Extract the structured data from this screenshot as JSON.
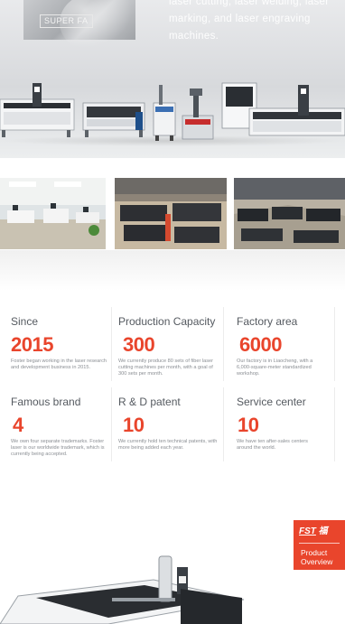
{
  "hero": {
    "photo_label": "SUPER FA",
    "text": "laser cutting, laser welding, laser marking, and laser engraving machines."
  },
  "stats": [
    {
      "title": "Since",
      "value": "2015",
      "desc": "Foster began working in the laser research and development business in 2015."
    },
    {
      "title": "Production Capacity",
      "value": "300",
      "desc": "We currently produce 80 sets of fiber laser cutting machines per month, with a goal of 300 sets per month."
    },
    {
      "title": "Factory area",
      "value": "6000",
      "desc": "Our factory is in Liaocheng, with a 6,000-square-meter standardized workshop."
    },
    {
      "title": "Famous brand",
      "value": "4",
      "desc": "We own four separate trademarks. Foster laser is our worldwide trademark, which is currently being accepted."
    },
    {
      "title": "R & D patent",
      "value": "10",
      "desc": "We currently hold ten technical patents, with more being added each year."
    },
    {
      "title": "Service center",
      "value": "10",
      "desc": "We have ten after-sales centers around the world."
    }
  ],
  "badge": {
    "logo": "FST",
    "logo_cn": "福",
    "label": "Product Overview"
  },
  "colors": {
    "accent": "#e9452c",
    "title_text": "#555a60",
    "desc_text": "#8a8e93"
  }
}
